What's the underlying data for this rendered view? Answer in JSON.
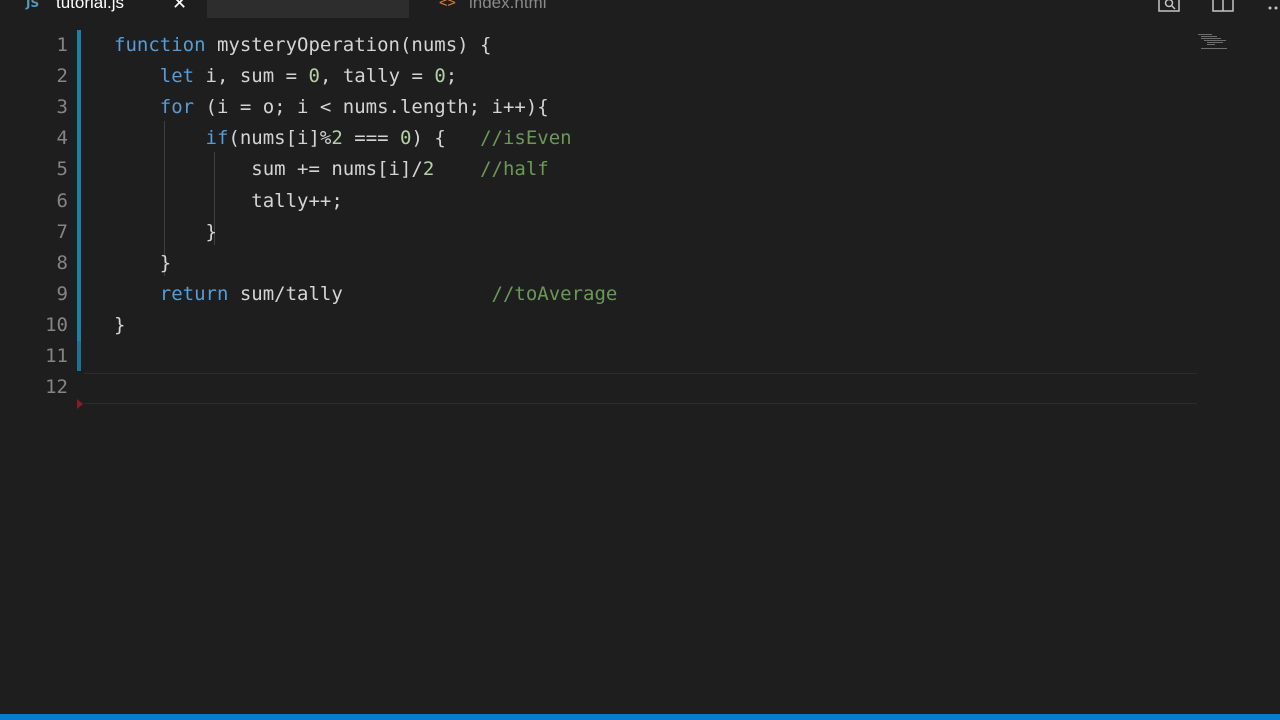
{
  "tabs": [
    {
      "icon": "JS",
      "label": "tutorial.js",
      "close": "✕",
      "active": true
    },
    {
      "icon": "<>",
      "label": "index.html",
      "active": false
    }
  ],
  "editor": {
    "lines": [
      {
        "num": "1",
        "tokens": [
          {
            "t": "kw",
            "v": "function"
          },
          {
            "t": "pl",
            "v": " mysteryOperation(nums) {"
          }
        ]
      },
      {
        "num": "2",
        "tokens": [
          {
            "t": "pl",
            "v": "    "
          },
          {
            "t": "kw",
            "v": "let"
          },
          {
            "t": "pl",
            "v": " i, sum = "
          },
          {
            "t": "num",
            "v": "0"
          },
          {
            "t": "pl",
            "v": ", tally = "
          },
          {
            "t": "num",
            "v": "0"
          },
          {
            "t": "pl",
            "v": ";"
          }
        ]
      },
      {
        "num": "3",
        "tokens": [
          {
            "t": "pl",
            "v": "    "
          },
          {
            "t": "kw",
            "v": "for"
          },
          {
            "t": "pl",
            "v": " (i = o; i < nums.length; i++){"
          }
        ]
      },
      {
        "num": "4",
        "tokens": [
          {
            "t": "pl",
            "v": "        "
          },
          {
            "t": "kw",
            "v": "if"
          },
          {
            "t": "pl",
            "v": "(nums[i]%"
          },
          {
            "t": "num",
            "v": "2"
          },
          {
            "t": "pl",
            "v": " === "
          },
          {
            "t": "num",
            "v": "0"
          },
          {
            "t": "pl",
            "v": ") {   "
          },
          {
            "t": "cm",
            "v": "//isEven"
          }
        ]
      },
      {
        "num": "5",
        "tokens": [
          {
            "t": "pl",
            "v": "            sum += nums[i]/"
          },
          {
            "t": "num",
            "v": "2"
          },
          {
            "t": "pl",
            "v": "    "
          },
          {
            "t": "cm",
            "v": "//half"
          }
        ]
      },
      {
        "num": "6",
        "tokens": [
          {
            "t": "pl",
            "v": "            tally++;"
          }
        ]
      },
      {
        "num": "7",
        "tokens": [
          {
            "t": "pl",
            "v": "        }"
          }
        ]
      },
      {
        "num": "8",
        "tokens": [
          {
            "t": "pl",
            "v": "    }"
          }
        ]
      },
      {
        "num": "9",
        "tokens": [
          {
            "t": "pl",
            "v": "    "
          },
          {
            "t": "kw",
            "v": "return"
          },
          {
            "t": "pl",
            "v": " sum/tally             "
          },
          {
            "t": "cm",
            "v": "//toAverage"
          }
        ]
      },
      {
        "num": "10",
        "tokens": [
          {
            "t": "pl",
            "v": "}"
          }
        ]
      },
      {
        "num": "11",
        "tokens": []
      },
      {
        "num": "12",
        "tokens": []
      }
    ]
  },
  "colors": {
    "background": "#1e1e1e",
    "keyword": "#569cd6",
    "number": "#b5cea8",
    "comment": "#6a9955",
    "text": "#d4d4d4",
    "line_number": "#858585",
    "git_modified": "#1b81a8",
    "status_bar": "#0a7aca"
  }
}
